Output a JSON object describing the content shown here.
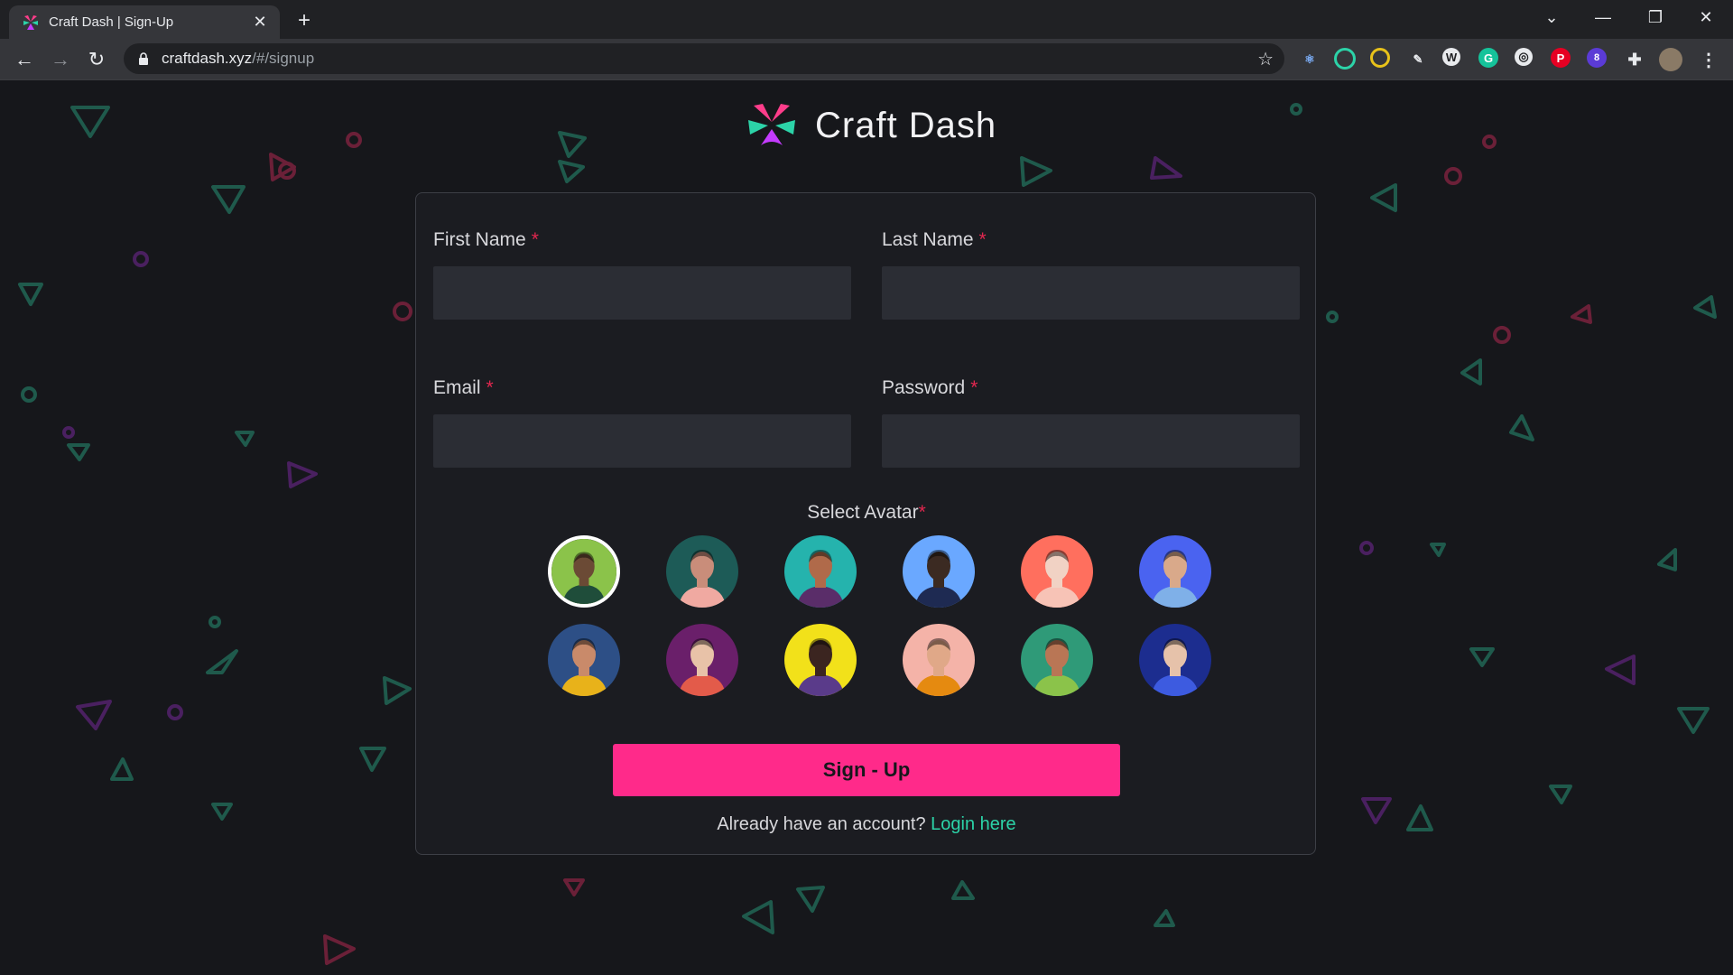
{
  "browser": {
    "tab_title": "Craft Dash | Sign-Up",
    "url_host": "craftdash.xyz",
    "url_path": "/#/signup",
    "extension_badge": "8"
  },
  "brand": {
    "name": "Craft Dash"
  },
  "form": {
    "first_name_label": "First Name",
    "last_name_label": "Last Name",
    "email_label": "Email",
    "password_label": "Password",
    "required_marker": "*",
    "first_name_value": "",
    "last_name_value": "",
    "email_value": "",
    "password_value": "",
    "avatar_label": "Select Avatar",
    "selected_avatar": 1,
    "avatars": [
      {
        "bg": "#8bc34a",
        "skin": "#6b4a35",
        "shirt": "#1f4d3a"
      },
      {
        "bg": "#1d5b57",
        "skin": "#c98d7a",
        "shirt": "#f0a9a1"
      },
      {
        "bg": "#25b3ad",
        "skin": "#b06a4a",
        "shirt": "#5a2d69"
      },
      {
        "bg": "#6aa8ff",
        "skin": "#3b2a22",
        "shirt": "#1e2a52"
      },
      {
        "bg": "#ff6f5e",
        "skin": "#f1d2c4",
        "shirt": "#f7c3b6"
      },
      {
        "bg": "#4a63f0",
        "skin": "#d9a98a",
        "shirt": "#7fb0e8"
      },
      {
        "bg": "#2d4f86",
        "skin": "#c98a6a",
        "shirt": "#e8b21a"
      },
      {
        "bg": "#6a1f6a",
        "skin": "#e8c2a8",
        "shirt": "#e35b4a"
      },
      {
        "bg": "#f2e11a",
        "skin": "#3b2520",
        "shirt": "#5a3b8a"
      },
      {
        "bg": "#f4b3a8",
        "skin": "#e0a888",
        "shirt": "#e58a10"
      },
      {
        "bg": "#2f9a78",
        "skin": "#b97655",
        "shirt": "#8bc34a"
      },
      {
        "bg": "#1c2d8f",
        "skin": "#e6c2aa",
        "shirt": "#3d5be0"
      }
    ],
    "submit_label": "Sign - Up",
    "login_prompt": "Already have an account?",
    "login_link": "Login here"
  },
  "colors": {
    "accent_pink": "#ff2a8a",
    "accent_teal": "#2cd3a8",
    "required_red": "#e2274f",
    "background": "#16171b"
  }
}
